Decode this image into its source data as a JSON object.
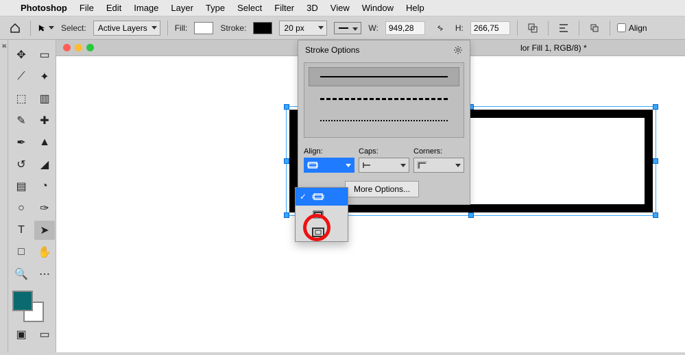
{
  "menubar": {
    "app": "Photoshop",
    "items": [
      "File",
      "Edit",
      "Image",
      "Layer",
      "Type",
      "Select",
      "Filter",
      "3D",
      "View",
      "Window",
      "Help"
    ]
  },
  "optbar": {
    "select_label": "Select:",
    "select_value": "Active Layers",
    "fill_label": "Fill:",
    "stroke_label": "Stroke:",
    "stroke_width": "20 px",
    "w_label": "W:",
    "w_value": "949,28",
    "h_label": "H:",
    "h_value": "266,75",
    "align_label": "Align"
  },
  "doc": {
    "title": "lor Fill 1, RGB/8) *"
  },
  "panel": {
    "title": "Stroke Options",
    "align_label": "Align:",
    "caps_label": "Caps:",
    "corners_label": "Corners:",
    "more": "More Options..."
  },
  "tools": {
    "items": [
      {
        "name": "move-tool",
        "glyph": "✥"
      },
      {
        "name": "marquee-tool",
        "glyph": "▭"
      },
      {
        "name": "lasso-tool",
        "glyph": "⟋"
      },
      {
        "name": "magic-wand-tool",
        "glyph": "✦"
      },
      {
        "name": "crop-tool",
        "glyph": "⬚"
      },
      {
        "name": "frame-tool",
        "glyph": "▥"
      },
      {
        "name": "eyedropper-tool",
        "glyph": "✎"
      },
      {
        "name": "healing-brush-tool",
        "glyph": "✚"
      },
      {
        "name": "brush-tool",
        "glyph": "✒"
      },
      {
        "name": "clone-stamp-tool",
        "glyph": "▲"
      },
      {
        "name": "history-brush-tool",
        "glyph": "↺"
      },
      {
        "name": "eraser-tool",
        "glyph": "◢"
      },
      {
        "name": "gradient-tool",
        "glyph": "▤"
      },
      {
        "name": "blur-tool",
        "glyph": "◔"
      },
      {
        "name": "dodge-tool",
        "glyph": "○"
      },
      {
        "name": "pen-tool",
        "glyph": "✑"
      },
      {
        "name": "type-tool",
        "glyph": "T"
      },
      {
        "name": "path-selection-tool",
        "glyph": "➤",
        "active": true
      },
      {
        "name": "rectangle-tool",
        "glyph": "□"
      },
      {
        "name": "hand-tool",
        "glyph": "✋"
      },
      {
        "name": "zoom-tool",
        "glyph": "🔍"
      },
      {
        "name": "edit-toolbar",
        "glyph": "⋯"
      }
    ]
  },
  "colors": {
    "fg": "#0b6a6f",
    "bg": "#ffffff",
    "accent": "#1f7bff",
    "highlight": "#e11"
  }
}
